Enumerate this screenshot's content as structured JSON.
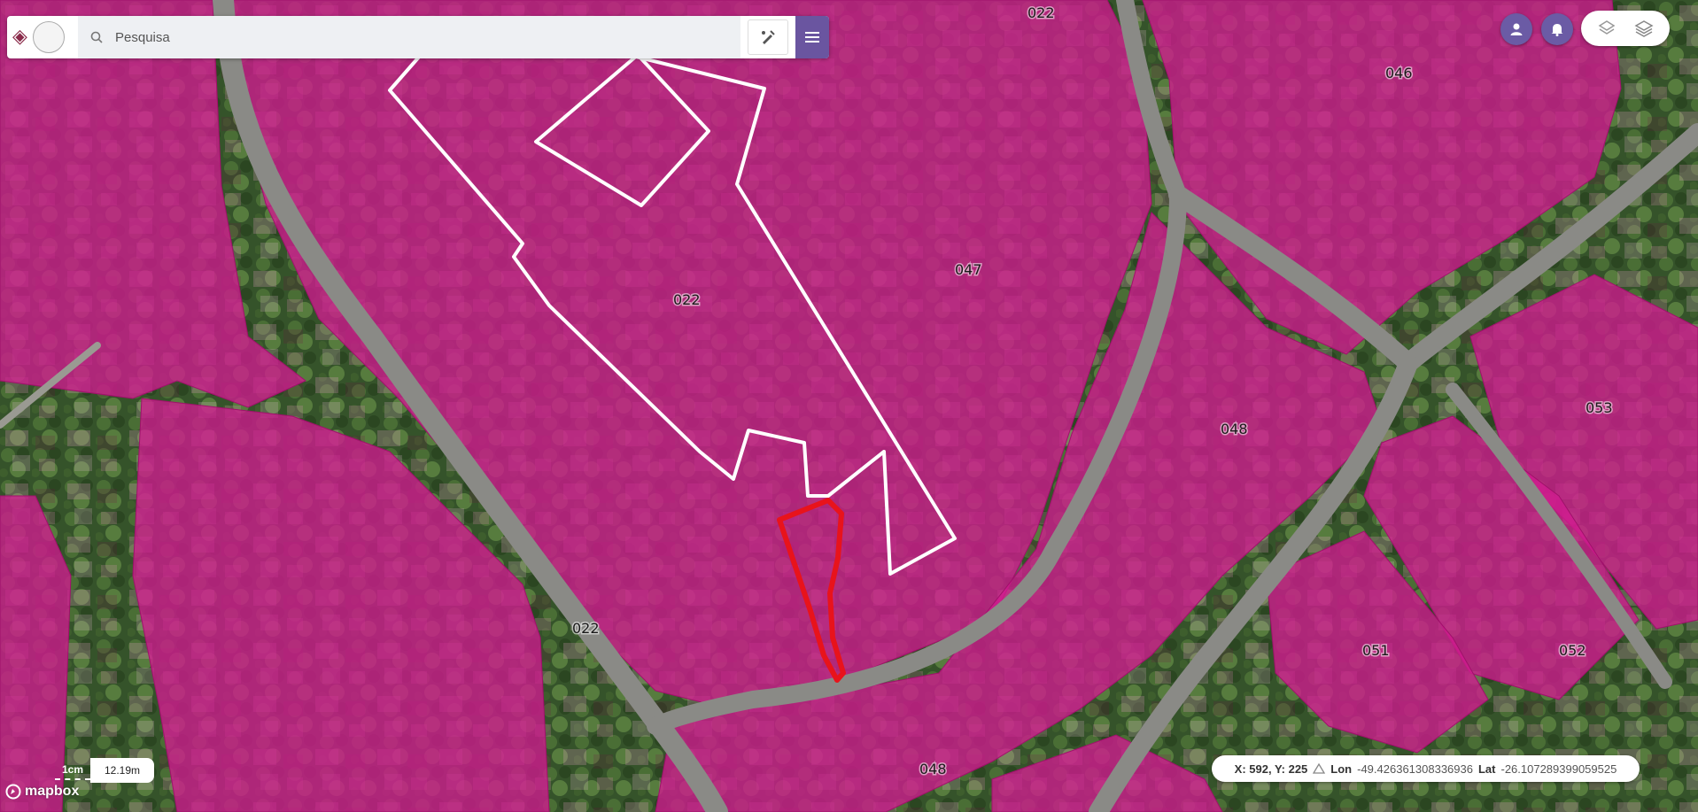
{
  "search": {
    "placeholder": "Pesquisa"
  },
  "logo": {
    "seal_text": ""
  },
  "parcels": {
    "labels": [
      "022",
      "046",
      "047",
      "022",
      "048",
      "053",
      "022",
      "051",
      "052",
      "048"
    ]
  },
  "scale": {
    "unit": "1cm",
    "value": "12.19m"
  },
  "attribution": {
    "brand": "mapbox"
  },
  "coordinates": {
    "xy": "X: 592, Y: 225",
    "lon_label": "Lon",
    "lon_value": "-49.426361308336936",
    "lat_label": "Lat",
    "lat_value": "-26.107289399059525"
  },
  "icons": {
    "search": "search-icon",
    "draw": "draw-tool-icon",
    "menu": "hamburger-menu-icon",
    "user": "user-icon",
    "bell": "bell-icon",
    "layers": "layers-icon",
    "layers_active": "layers-stack-icon"
  },
  "colors": {
    "parcel_fill": "#d11b8f",
    "parcel_outline": "#ffffff",
    "selection_outline": "#e8131b",
    "accent": "#6a55a0"
  }
}
